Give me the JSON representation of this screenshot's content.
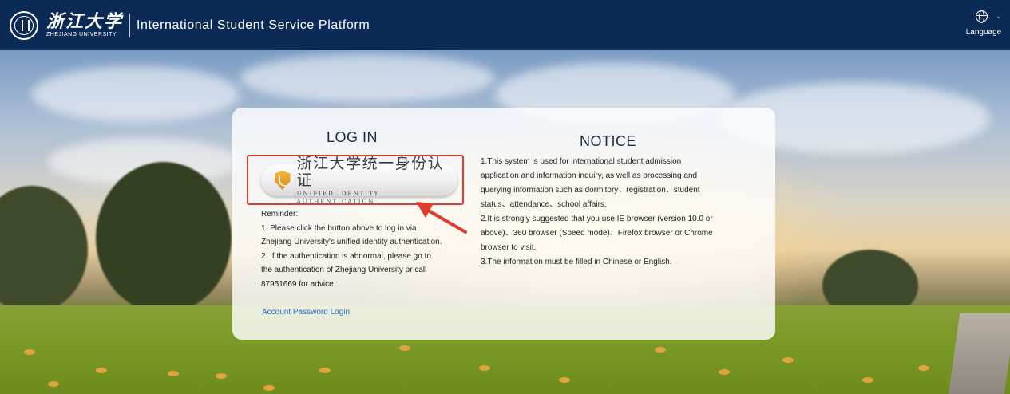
{
  "header": {
    "brand_cn": "浙江大学",
    "brand_en": "ZHEJIANG UNIVERSITY",
    "platform_title": "International Student Service Platform",
    "language_label": "Language"
  },
  "login": {
    "title": "LOG IN",
    "auth_button_cn": "浙江大学统一身份认证",
    "auth_button_en": "UNIFIED IDENTITY AUTHENTICATION",
    "reminder_lines": [
      "Reminder:",
      "1. Please click the button above to log in via",
      "Zhejiang University's unified identity authentication.",
      "2. If the authentication is abnormal, please go to",
      "the authentication of Zhejiang University or call",
      "87951669 for advice."
    ],
    "account_link": "Account Password Login"
  },
  "notice": {
    "title": "NOTICE",
    "lines": [
      "1.This system is used for international student admission",
      "application and information inquiry,  as well as processing and",
      "querying information such as dormitory、registration、student",
      "status、attendance、school affairs.",
      "2.It is strongly suggested that you use IE browser (version 10.0 or",
      "above)、360 browser (Speed mode)、Firefox browser or Chrome",
      "browser to visit.",
      "3.The information must be filled in Chinese or English."
    ]
  },
  "colors": {
    "header_bg": "#0b2a55",
    "highlight_border": "#e23b2e",
    "link": "#2a6fc9"
  }
}
